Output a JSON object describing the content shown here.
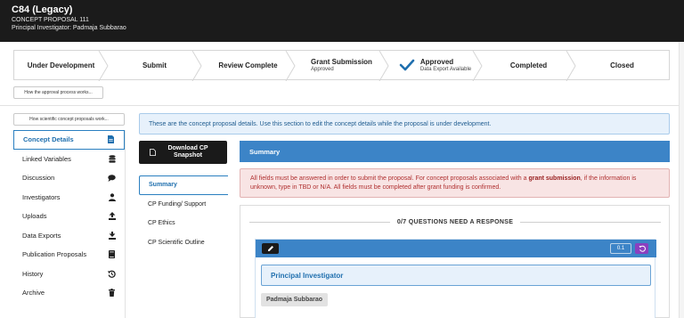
{
  "header": {
    "title": "C84 (Legacy)",
    "proposal_id": "CONCEPT PROPOSAL 111",
    "investigator": "Principal Investigator: Padmaja Subbarao"
  },
  "steps": [
    {
      "label": "Under Development",
      "sub": ""
    },
    {
      "label": "Submit",
      "sub": ""
    },
    {
      "label": "Review Complete",
      "sub": ""
    },
    {
      "label": "Grant Submission",
      "sub": "Approved"
    },
    {
      "label": "Approved",
      "sub": "Data Export Available"
    },
    {
      "label": "Completed",
      "sub": ""
    },
    {
      "label": "Closed",
      "sub": ""
    }
  ],
  "buttons": {
    "approval_process": "How the approval process works...",
    "scientific_process": "How scientific concept proposals work...",
    "download": "Download CP Snapshot"
  },
  "sidebar": {
    "items": [
      {
        "label": "Concept Details",
        "icon": "document-icon"
      },
      {
        "label": "Linked Variables",
        "icon": "database-icon"
      },
      {
        "label": "Discussion",
        "icon": "chat-icon"
      },
      {
        "label": "Investigators",
        "icon": "user-icon"
      },
      {
        "label": "Uploads",
        "icon": "upload-icon"
      },
      {
        "label": "Data Exports",
        "icon": "download-icon"
      },
      {
        "label": "Publication Proposals",
        "icon": "book-icon"
      },
      {
        "label": "History",
        "icon": "history-icon"
      },
      {
        "label": "Archive",
        "icon": "trash-icon"
      }
    ]
  },
  "info_banner": "These are the concept proposal details. Use this section to edit the concept details while the proposal is under development.",
  "subnav": {
    "items": [
      "Summary",
      "CP Funding/ Support",
      "CP Ethics",
      "CP Scientific Outline"
    ]
  },
  "summary": {
    "title": "Summary",
    "warning_prefix": "All fields must be answered in order to submit the proposal. For concept proposals associated with a ",
    "warning_bold": "grant submission",
    "warning_suffix": ", if the information is unknown, type in TBD or N/A. All fields must be completed after grant funding is confirmed.",
    "questions_header": "0/7 QUESTIONS NEED A RESPONSE",
    "score": "0.1",
    "question_label": "Principal Investigator",
    "question_value": "Padmaja Subbarao"
  },
  "colors": {
    "header_bg": "#1b1b1b",
    "accent_blue": "#3c84c7",
    "link_blue": "#1f6fae",
    "warning_text": "#b03030",
    "warning_bg": "#f8e4e4",
    "undo_purple": "#8b3fbf"
  }
}
